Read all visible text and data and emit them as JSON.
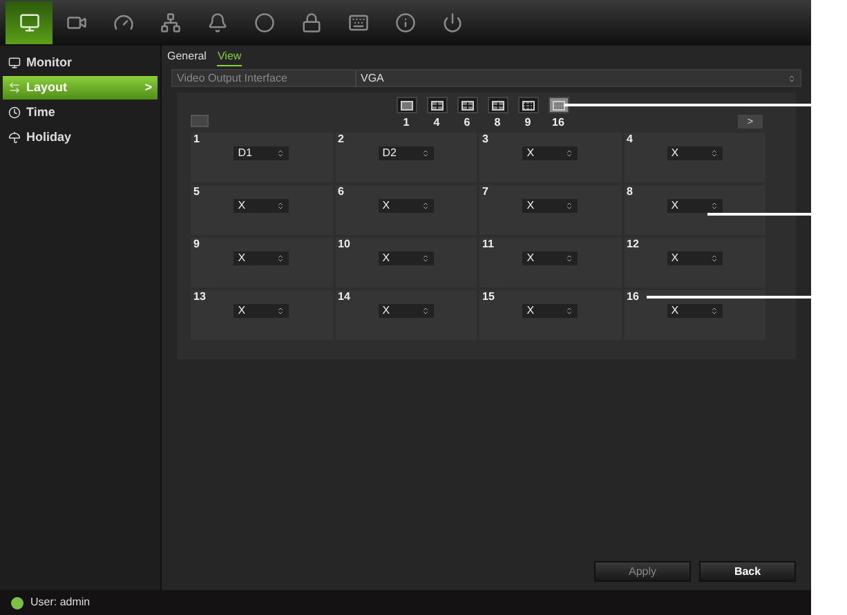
{
  "toolbar": [
    {
      "selected": true
    },
    {
      "selected": false
    },
    {
      "selected": false
    },
    {
      "selected": false
    },
    {
      "selected": false
    },
    {
      "selected": false
    },
    {
      "selected": false
    },
    {
      "selected": false
    },
    {
      "selected": false
    },
    {
      "selected": false
    }
  ],
  "sidebar": {
    "items": [
      {
        "label": "Monitor",
        "selected": false
      },
      {
        "label": "Layout",
        "selected": true,
        "arrow": ">"
      },
      {
        "label": "Time",
        "selected": false
      },
      {
        "label": "Holiday",
        "selected": false
      }
    ]
  },
  "tabs": [
    {
      "label": "General",
      "selected": false
    },
    {
      "label": "View",
      "selected": true
    }
  ],
  "output_field": {
    "label": "Video Output Interface",
    "value": "VGA"
  },
  "layout_buttons": [
    {
      "label": "1",
      "selected": false
    },
    {
      "label": "4",
      "selected": false
    },
    {
      "label": "6",
      "selected": false
    },
    {
      "label": "8",
      "selected": false
    },
    {
      "label": "9",
      "selected": false
    },
    {
      "label": "16",
      "selected": true
    }
  ],
  "pager": {
    "next": ">"
  },
  "cells": [
    {
      "number": "1",
      "value": "D1"
    },
    {
      "number": "2",
      "value": "D2"
    },
    {
      "number": "3",
      "value": "X"
    },
    {
      "number": "4",
      "value": "X"
    },
    {
      "number": "5",
      "value": "X"
    },
    {
      "number": "6",
      "value": "X"
    },
    {
      "number": "7",
      "value": "X"
    },
    {
      "number": "8",
      "value": "X"
    },
    {
      "number": "9",
      "value": "X"
    },
    {
      "number": "10",
      "value": "X"
    },
    {
      "number": "11",
      "value": "X"
    },
    {
      "number": "12",
      "value": "X"
    },
    {
      "number": "13",
      "value": "X"
    },
    {
      "number": "14",
      "value": "X"
    },
    {
      "number": "15",
      "value": "X"
    },
    {
      "number": "16",
      "value": "X"
    }
  ],
  "buttons": [
    {
      "label": "Apply",
      "disabled": true
    },
    {
      "label": "Back",
      "disabled": false
    }
  ],
  "status_bar": {
    "user": "User: admin"
  }
}
